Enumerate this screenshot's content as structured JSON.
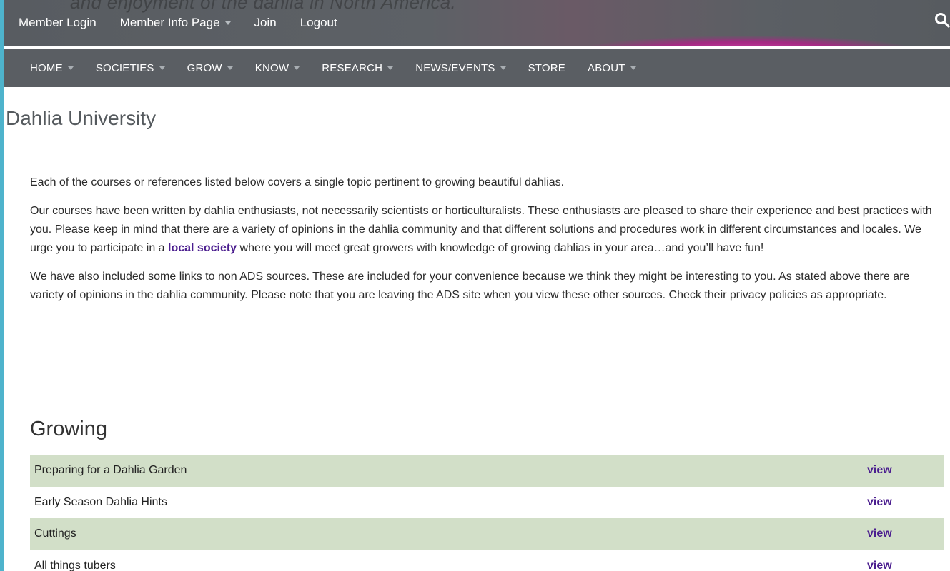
{
  "topbar": {
    "tagline": "and enjoyment of the dahlia in North America.",
    "links": [
      {
        "label": "Member Login",
        "dropdown": false
      },
      {
        "label": "Member Info Page",
        "dropdown": true
      },
      {
        "label": "Join",
        "dropdown": false
      },
      {
        "label": "Logout",
        "dropdown": false
      }
    ],
    "search_icon": "search-icon"
  },
  "nav": {
    "items": [
      {
        "label": "HOME",
        "dropdown": true
      },
      {
        "label": "SOCIETIES",
        "dropdown": true
      },
      {
        "label": "GROW",
        "dropdown": true
      },
      {
        "label": "KNOW",
        "dropdown": true
      },
      {
        "label": "RESEARCH",
        "dropdown": true
      },
      {
        "label": "NEWS/EVENTS",
        "dropdown": true
      },
      {
        "label": "STORE",
        "dropdown": false
      },
      {
        "label": "ABOUT",
        "dropdown": true
      }
    ]
  },
  "page": {
    "title": "Dahlia University",
    "intro": "Each of the courses or references listed below covers a single topic pertinent to growing beautiful dahlias.",
    "para2_before": "Our courses have been written by dahlia enthusiasts, not necessarily scientists or horticulturalists. These enthusiasts are pleased to share their experience and best practices with you. Please keep in mind that there are a variety of opinions in the dahlia community and that different solutions and procedures work in different circumstances and locales. We urge you to participate in a ",
    "para2_link": "local society",
    "para2_after": " where you will meet great growers with knowledge of growing dahlias in your area…and you’ll have fun!",
    "para3": "We have also included some links to non ADS sources.  These are included for your convenience because we think they might be interesting to you.  As stated above there are variety of opinions in the dahlia community.  Please note that you are leaving the ADS site when you view these other sources. Check their privacy policies as appropriate."
  },
  "growing": {
    "title": "Growing",
    "rows": [
      {
        "name": "Preparing for a Dahlia Garden",
        "action": "view"
      },
      {
        "name": "Early Season Dahlia Hints",
        "action": "view"
      },
      {
        "name": "Cuttings",
        "action": "view"
      },
      {
        "name": "All things tubers",
        "action": "view"
      }
    ]
  },
  "colors": {
    "accent_link": "#4b1e8f",
    "row_shade": "#d2dfc8",
    "nav_bg": "#5a5e63",
    "page_border": "#4eb3cc"
  }
}
